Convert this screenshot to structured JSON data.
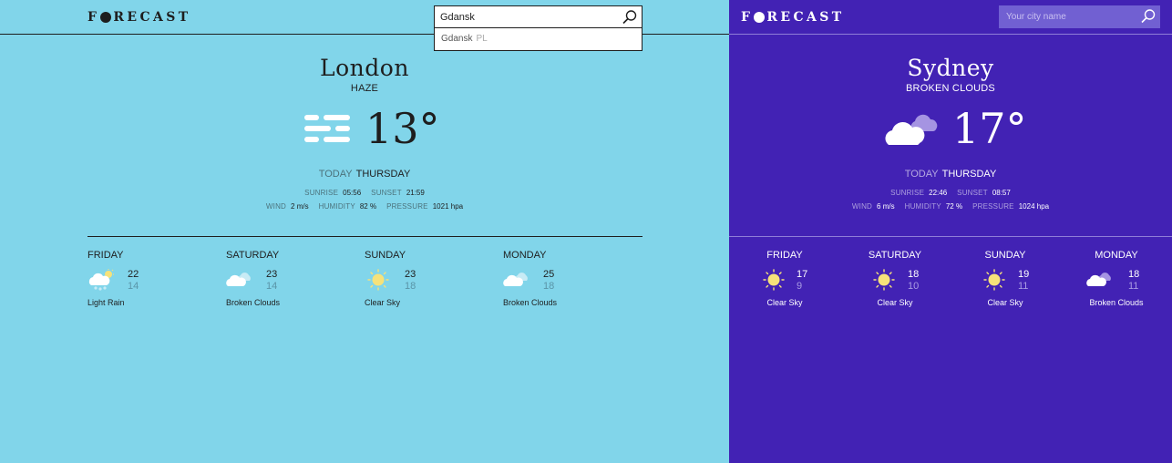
{
  "left": {
    "logo": "FORECAST",
    "search": {
      "value": "Gdansk",
      "suggestion_city": "Gdansk",
      "suggestion_country": "PL"
    },
    "city": "London",
    "condition": "HAZE",
    "temperature": "13°",
    "icon": "haze-icon",
    "today_label": "TODAY",
    "weekday": "THURSDAY",
    "sunrise_label": "SUNRISE",
    "sunrise": "05:56",
    "sunset_label": "SUNSET",
    "sunset": "21:59",
    "wind_label": "WIND",
    "wind": "2 m/s",
    "humidity_label": "HUMIDITY",
    "humidity": "82 %",
    "pressure_label": "PRESSURE",
    "pressure": "1021 hpa",
    "forecast": [
      {
        "day": "FRIDAY",
        "hi": "22",
        "lo": "14",
        "desc": "Light Rain",
        "icon": "rain-icon"
      },
      {
        "day": "SATURDAY",
        "hi": "23",
        "lo": "14",
        "desc": "Broken Clouds",
        "icon": "broken-clouds-icon"
      },
      {
        "day": "SUNDAY",
        "hi": "23",
        "lo": "18",
        "desc": "Clear Sky",
        "icon": "sun-icon"
      },
      {
        "day": "MONDAY",
        "hi": "25",
        "lo": "18",
        "desc": "Broken Clouds",
        "icon": "broken-clouds-icon"
      }
    ],
    "colors": {
      "background": "#81d5ea",
      "text": "#1e1e1e",
      "sun": "#f6e27a"
    }
  },
  "right": {
    "logo": "FORECAST",
    "search": {
      "placeholder": "Your city name"
    },
    "city": "Sydney",
    "condition": "BROKEN CLOUDS",
    "temperature": "17°",
    "icon": "broken-clouds-icon",
    "today_label": "TODAY",
    "weekday": "THURSDAY",
    "sunrise_label": "SUNRISE",
    "sunrise": "22:46",
    "sunset_label": "SUNSET",
    "sunset": "08:57",
    "wind_label": "WIND",
    "wind": "6 m/s",
    "humidity_label": "HUMIDITY",
    "humidity": "72 %",
    "pressure_label": "PRESSURE",
    "pressure": "1024 hpa",
    "forecast": [
      {
        "day": "FRIDAY",
        "hi": "17",
        "lo": "9",
        "desc": "Clear Sky",
        "icon": "sun-icon"
      },
      {
        "day": "SATURDAY",
        "hi": "18",
        "lo": "10",
        "desc": "Clear Sky",
        "icon": "sun-icon"
      },
      {
        "day": "SUNDAY",
        "hi": "19",
        "lo": "11",
        "desc": "Clear Sky",
        "icon": "sun-icon"
      },
      {
        "day": "MONDAY",
        "hi": "18",
        "lo": "11",
        "desc": "Broken Clouds",
        "icon": "broken-clouds-icon"
      }
    ],
    "colors": {
      "background": "#4222b4",
      "text": "#ffffff",
      "sun": "#f6e27a"
    }
  }
}
